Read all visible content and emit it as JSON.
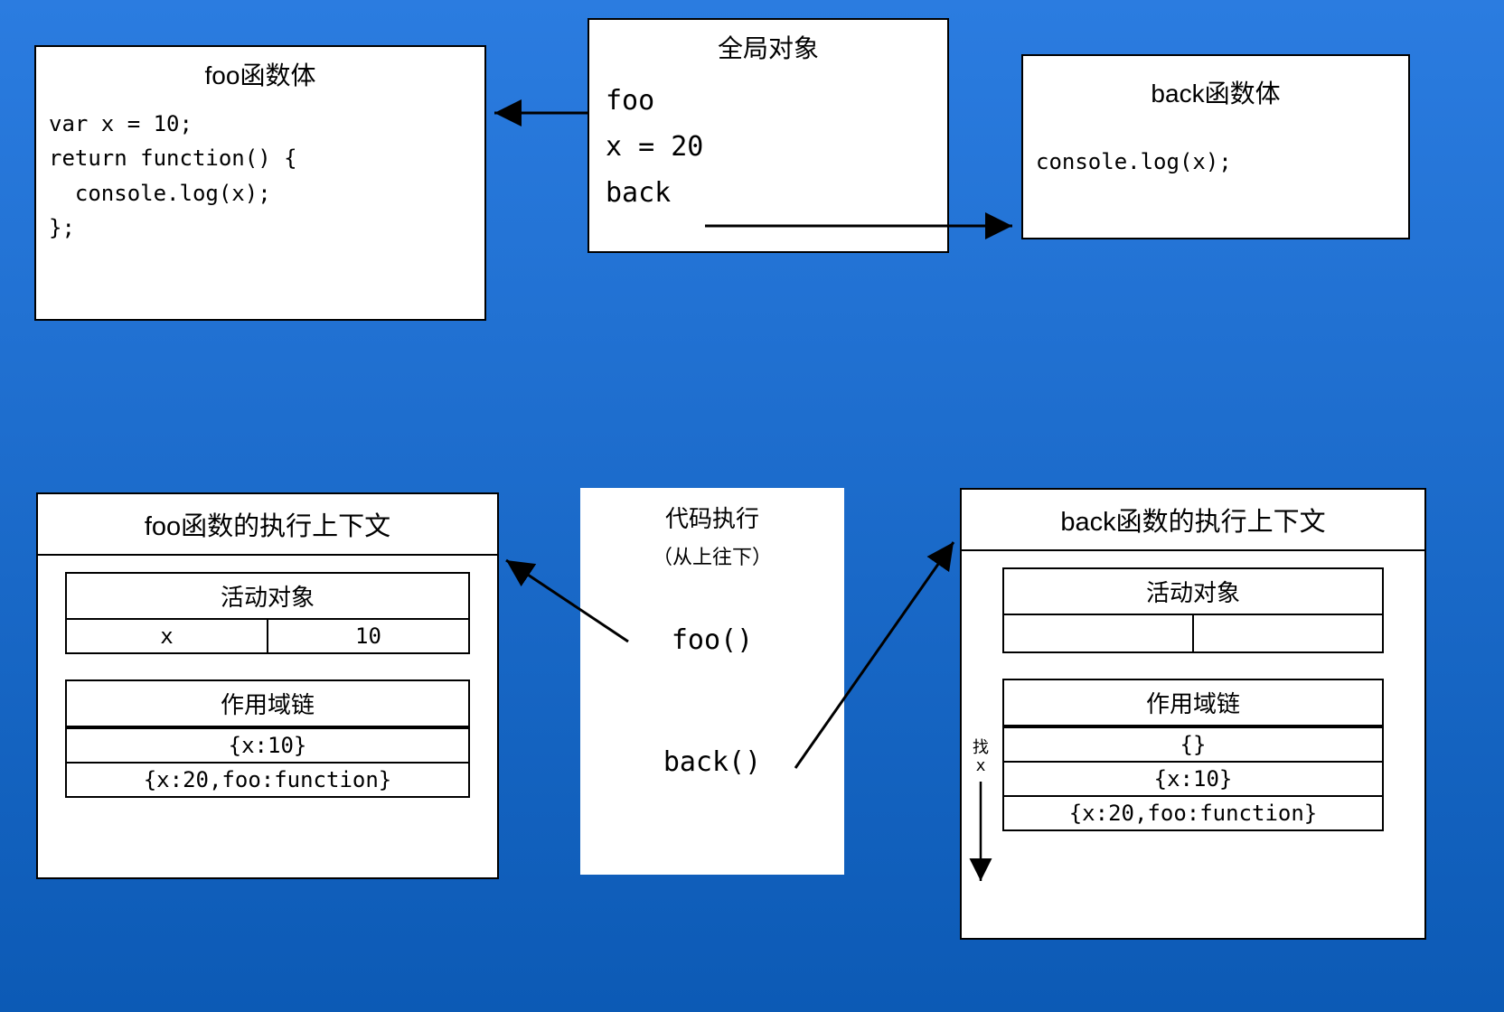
{
  "fooBody": {
    "title": "foo函数体",
    "code": "var x = 10;\nreturn function() {\n  console.log(x);\n};"
  },
  "globalObj": {
    "title": "全局对象",
    "line1": "foo",
    "line2": "x = 20",
    "line3": "back"
  },
  "backBody": {
    "title": "back函数体",
    "code": "console.log(x);"
  },
  "fooCtx": {
    "title": "foo函数的执行上下文",
    "aoTitle": "活动对象",
    "aoKey": "x",
    "aoVal": "10",
    "scTitle": "作用域链",
    "sc1": "{x:10}",
    "sc2": "{x:20,foo:function}"
  },
  "exec": {
    "title": "代码执行",
    "subtitle": "（从上往下）",
    "call1": "foo()",
    "call2": "back()"
  },
  "backCtx": {
    "title": "back函数的执行上下文",
    "aoTitle": "活动对象",
    "scTitle": "作用域链",
    "sc1": "{}",
    "sc2": "{x:10}",
    "sc3": "{x:20,foo:function}"
  },
  "findLabel1": "找",
  "findLabel2": "x"
}
